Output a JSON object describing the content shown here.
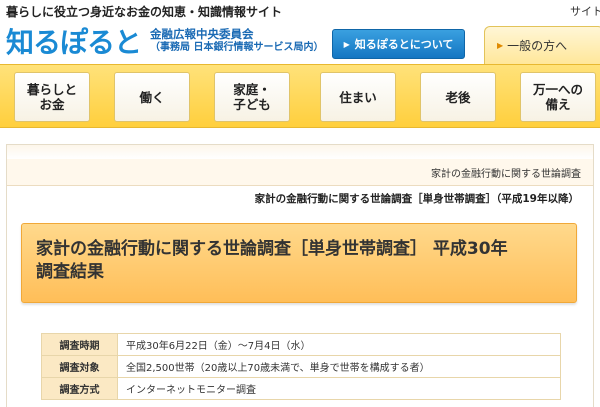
{
  "header": {
    "tagline": "暮らしに役立つ身近なお金の知恵・知識情報サイト",
    "site_link": "サイト内",
    "logo_text": "知るぽると",
    "org_line1": "金融広報中央委員会",
    "org_line2": "（事務局 日本銀行情報サービス局内）",
    "about_button": "知るぽるとについて",
    "general_tab": "一般の方へ"
  },
  "nav": {
    "items": [
      {
        "label": "暮らしと\nお金"
      },
      {
        "label": "働く"
      },
      {
        "label": "家庭・\n子ども"
      },
      {
        "label": "住まい"
      },
      {
        "label": "老後"
      },
      {
        "label": "万一への\n備え"
      }
    ]
  },
  "main": {
    "breadcrumb": "家計の金融行動に関する世論調査",
    "subtitle": "家計の金融行動に関する世論調査［単身世帯調査］（平成19年以降）",
    "title_line1": "家計の金融行動に関する世論調査［単身世帯調査］ 平成30年",
    "title_line2": "調査結果",
    "table": [
      {
        "label": "調査時期",
        "value": "平成30年6月22日（金）～7月4日（水）"
      },
      {
        "label": "調査対象",
        "value": "全国2,500世帯（20歳以上70歳未満で、単身で世帯を構成する者）"
      },
      {
        "label": "調査方式",
        "value": "インターネットモニター調査"
      }
    ]
  },
  "colors": {
    "brand_blue": "#1a8ad4",
    "nav_yellow": "#ffcf3d",
    "title_orange": "#ffbe58"
  }
}
